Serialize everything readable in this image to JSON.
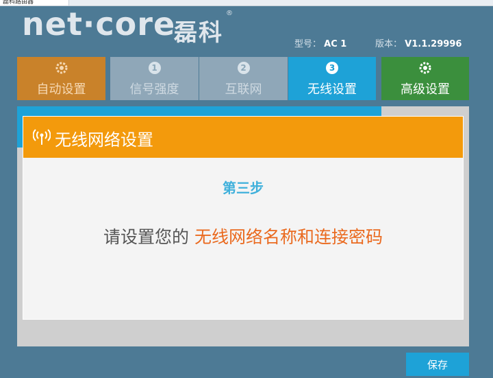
{
  "browser": {
    "tab_title": "磊科路由器"
  },
  "brand": {
    "logo": "net·core",
    "logo_cn": "磊科",
    "reg_mark": "®"
  },
  "meta": {
    "model_label": "型号：",
    "model_value": "AC 1",
    "version_label": "版本：",
    "version_value": "V1.1.29996"
  },
  "nav": [
    {
      "label": "自动设置",
      "icon": "gear-refresh-icon"
    },
    {
      "label": "信号强度",
      "step": "1"
    },
    {
      "label": "互联网",
      "step": "2"
    },
    {
      "label": "无线设置",
      "step": "3"
    },
    {
      "label": "高级设置",
      "icon": "gear-icon"
    }
  ],
  "card": {
    "title": "无线网络设置",
    "step": "第三步",
    "instruction_prefix": "请设置您的",
    "instruction_highlight": "无线网络名称和连接密码"
  },
  "save_label": "保存",
  "colors": {
    "accent_orange": "#f39a0c",
    "accent_blue": "#1ea2d7",
    "accent_green": "#3b8f3d"
  }
}
